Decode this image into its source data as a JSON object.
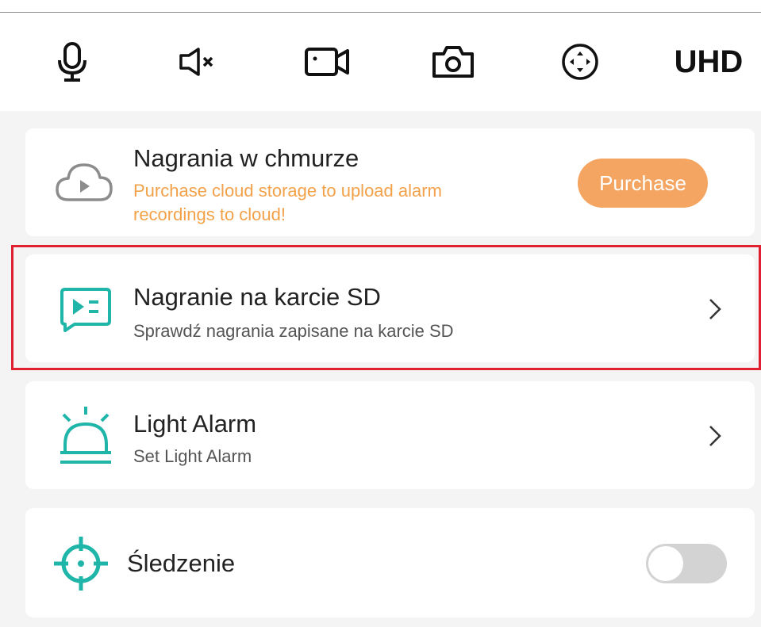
{
  "toolbar": {
    "icons": [
      "microphone-icon",
      "speaker-muted-icon",
      "video-record-icon",
      "camera-snapshot-icon",
      "ptz-direction-icon"
    ],
    "quality_label": "UHD"
  },
  "cards": {
    "cloud": {
      "icon": "cloud-play-icon",
      "title": "Nagrania w chmurze",
      "subtitle": "Purchase cloud storage to upload alarm recordings to cloud!",
      "button_label": "Purchase"
    },
    "sd": {
      "icon": "sd-playback-icon",
      "title": "Nagranie na karcie SD",
      "subtitle": "Sprawdź nagrania zapisane na karcie SD"
    },
    "light_alarm": {
      "icon": "siren-icon",
      "title": "Light Alarm",
      "subtitle": "Set Light Alarm"
    },
    "tracking": {
      "icon": "crosshair-icon",
      "title": "Śledzenie",
      "toggle_on": false
    }
  },
  "colors": {
    "accent_teal": "#1fb5a8",
    "orange": "#f3a149",
    "purchase_button": "#f3a561",
    "highlight_red": "#e0202f",
    "toggle_off": "#d3d3d3"
  }
}
